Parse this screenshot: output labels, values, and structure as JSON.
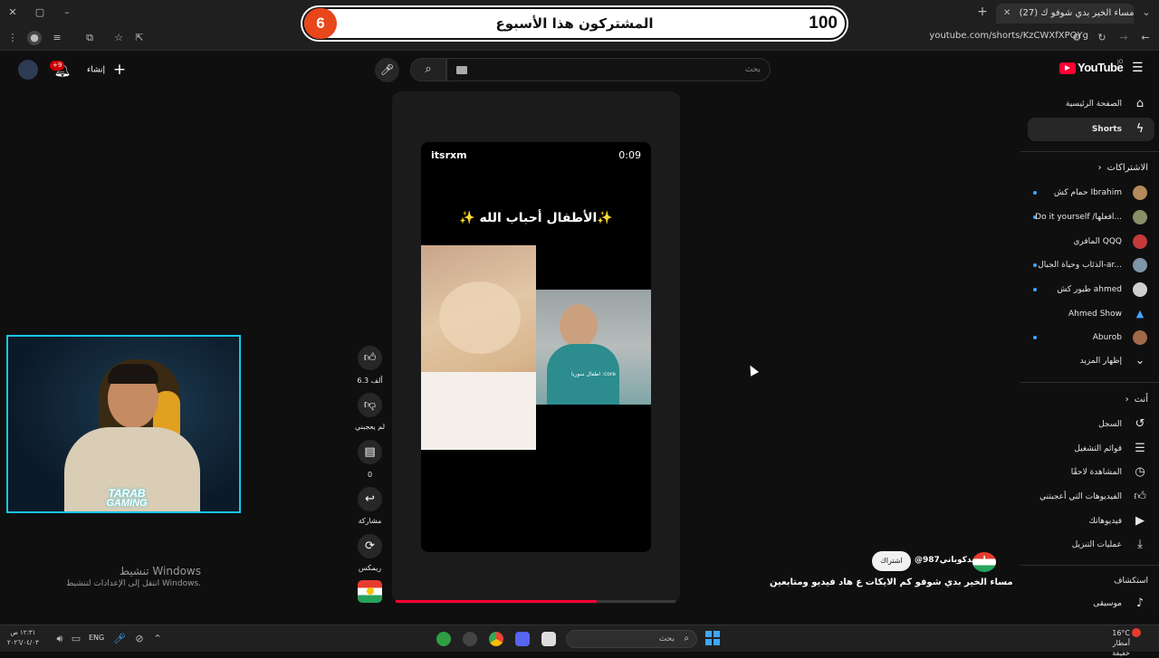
{
  "browser": {
    "tab_active": "(27) مساء الخير بدي شوفو ك",
    "url": "youtube.com/shorts/KzCWXfXPQYg"
  },
  "banner": {
    "number_left": "6",
    "title": "المشتركون هذا الأسبوع",
    "number_right": "100"
  },
  "header": {
    "create_label": "إنشاء",
    "notif_count": "+9",
    "search_placeholder": "بحث",
    "logo_text": "YouTube",
    "country": "JO"
  },
  "sidebar": {
    "main": [
      {
        "label": "الصفحة الرئيسية",
        "icon": "home-icon"
      },
      {
        "label": "Shorts",
        "icon": "shorts-icon"
      }
    ],
    "subscriptions_title": "الاشتراكات",
    "subscriptions": [
      {
        "label": "حمام كش Ibrahim",
        "dot": true,
        "color": "#b38a5a"
      },
      {
        "label": "Do it yourself /ﺍﻓﻌﻠﻬﺎ...",
        "dot": true,
        "color": "#8a8f6a"
      },
      {
        "label": "المافري QQQ",
        "dot": false,
        "color": "#c43a3a"
      },
      {
        "label": "الذئاب وحياة الجبال-ar...",
        "dot": true,
        "color": "#7f95a8"
      },
      {
        "label": "طيور كش ahmed",
        "dot": true,
        "color": "#cfcfcf"
      },
      {
        "label": "Ahmed Show",
        "dot": false,
        "color": "#3ea6ff"
      },
      {
        "label": "Aburob",
        "dot": true,
        "color": "#a06a4a"
      }
    ],
    "show_more": "إظهار المزيد",
    "you_title": "أنت",
    "you": [
      {
        "label": "السجل",
        "icon": "history-icon"
      },
      {
        "label": "قوائم التشغيل",
        "icon": "playlists-icon"
      },
      {
        "label": "المشاهدة لاحقًا",
        "icon": "clock-icon"
      },
      {
        "label": "الفيديوهات التي أعجبتني",
        "icon": "like-icon"
      },
      {
        "label": "فيديوهاتك",
        "icon": "your-videos-icon"
      },
      {
        "label": "عمليات التنزيل",
        "icon": "download-icon"
      }
    ],
    "explore_title": "استكشاف",
    "explore": [
      {
        "label": "موسيقى",
        "icon": "music-icon"
      }
    ]
  },
  "video": {
    "channel": "itsrxm",
    "time": "0:09",
    "caption": "✨ الأطفال أحباب الله✨",
    "child_caption": "اطفال سوريا :core",
    "progress": 0.72
  },
  "actions": {
    "likes": "6.3 ألف",
    "dislike": "لم يعجبني",
    "comments": "0",
    "share": "مشاركة",
    "remix": "ريمكس"
  },
  "info": {
    "handle": "@احمدكوباني987",
    "subscribe": "اشتراك",
    "title": "مساء الخير بدي شوفو كم الايكات ع هاد فيديو ومتابعين"
  },
  "watermark": {
    "line1": "تنشيط Windows",
    "line2": "انتقل إلى الإعدادات لتنشيط Windows."
  },
  "webcam": {
    "logo_line1": "TARAB",
    "logo_line2": "GAMING"
  },
  "taskbar": {
    "time": "١٢:٣١ ص",
    "date": "٢٠٢٦/٠٤/٠٣",
    "lang": "ENG",
    "search": "بحث",
    "temp": "16°C",
    "weather": "أمطار خفيفة"
  }
}
